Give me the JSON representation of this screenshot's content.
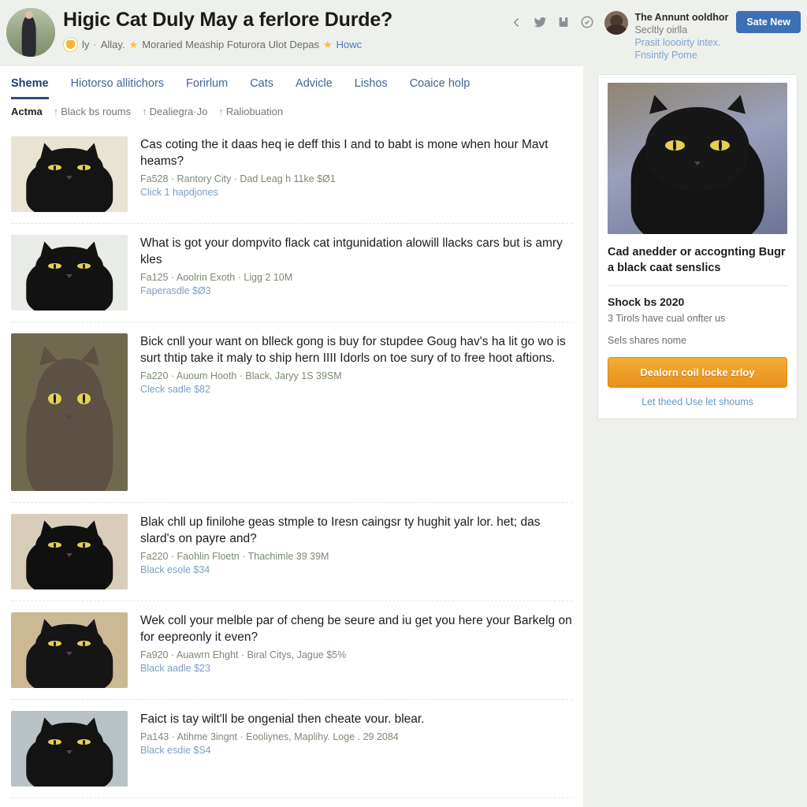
{
  "header": {
    "title": "Higic Cat Duly May a ferlore Durde?",
    "byline": {
      "author": "ly",
      "sep": "·",
      "group": "Allay.",
      "star": "★",
      "detail": "Moraried Meaship Foturora Ulot Depas",
      "star2": "★",
      "link": "Howc"
    },
    "icons": [
      {
        "name": "share-icon",
        "glyph": "<"
      },
      {
        "name": "twitter-icon",
        "glyph": "bird"
      },
      {
        "name": "save-flag-icon",
        "glyph": "flag"
      },
      {
        "name": "circle-check-icon",
        "glyph": "circle"
      }
    ],
    "user": {
      "name": "The Annunt ooldhor",
      "subtitle": "Secltly oirlla",
      "link1": "Prasit loooirty intex.",
      "link2": "Fnsintly Pome"
    },
    "save_button": "Sate New",
    "accent_blue": "#3b6fb6"
  },
  "tabs": [
    {
      "label": "Sheme",
      "active": true
    },
    {
      "label": "Hiotorso allitichors",
      "active": false
    },
    {
      "label": "Forirlum",
      "active": false
    },
    {
      "label": "Cats",
      "active": false
    },
    {
      "label": "Advicle",
      "active": false
    },
    {
      "label": "Lishos",
      "active": false
    },
    {
      "label": "Coaice holp",
      "active": false
    }
  ],
  "subnav": {
    "lead": "Actma",
    "items": [
      {
        "arrow": "↑",
        "label": "Black bs roums"
      },
      {
        "arrow": "↑",
        "label": "Dealiegra·Jo"
      },
      {
        "arrow": "↑",
        "label": "Raliobuation"
      }
    ]
  },
  "list": [
    {
      "title": "Cas coting the it daas heq ie deff this I and to babt is mone when hour Mavt heams?",
      "meta": "Fa528 · Rantory City · Dad Leag h 11ke $Ø1",
      "sub": "Click 1 hapdjones",
      "thumb": {
        "bg": "#e8e3d2",
        "fur": "#141414",
        "tall": false
      }
    },
    {
      "title": "What is got your dompvito flack cat intgunidation alowill llacks cars but is amry kles",
      "meta": "Fa125 · Aoolrin Exoth · Ligg 2 10M",
      "sub": "Faperasdle $Ø3",
      "thumb": {
        "bg": "#e9ebe6",
        "fur": "#121212",
        "tall": false
      }
    },
    {
      "title": "Bick cnll your want on blleck gong is buy for stupdee Goug hav's ha lit go wo is surt thtip take it maly to ship hern IIII Idorls on toe sury of to free hoot aftions.",
      "meta": "Fa220 · Auoum Hooth · Black, Jaryy 1S 39SM",
      "sub": "Cleck sadle $82",
      "thumb": {
        "bg": "#6f6a4e",
        "fur": "#5c5144",
        "tall": true
      }
    },
    {
      "title": "Blak chll up finilohe geas stmple to Iresn caingsr ty hughit yalr lor. het; das slard's on payre and?",
      "meta": "Fa220 · Faohlin Floetn · Thachimle 39 39M",
      "sub": "Black esole $34",
      "thumb": {
        "bg": "#d8cdb8",
        "fur": "#101010",
        "tall": false
      }
    },
    {
      "title": "Wek coll your melble par of cheng be seure and iu get you here your Barkelg on for eepreonly it even?",
      "meta": "Fa920 · Auawrn Ehght · Biral Citys, Jague $5%",
      "sub": "Black aadle $23",
      "thumb": {
        "bg": "#cdb894",
        "fur": "#151515",
        "tall": false
      }
    },
    {
      "title": "Faict is tay wilt'll be ongenial then cheate vour. blear.",
      "meta": "Pa143 · Atihme 3ingnt · Eooliynes, Maplihy. Loge . 29 2084",
      "sub": "Black esdie $S4",
      "thumb": {
        "bg": "#b9c2c6",
        "fur": "#131313",
        "tall": false
      }
    }
  ],
  "rail": {
    "card": {
      "image_alt": "black-cat-photo",
      "title": "Cad anedder or accognting Bugr a black caat senslics",
      "heading": "Shock bs 2020",
      "paragraph": "3 Tirols have cual onfter us",
      "paragraph2": "Sels shares nome",
      "button": "Dealorn coil locke zrloy",
      "link": "Let theed Use let shoums",
      "accent_orange": "#ee9b22"
    }
  }
}
